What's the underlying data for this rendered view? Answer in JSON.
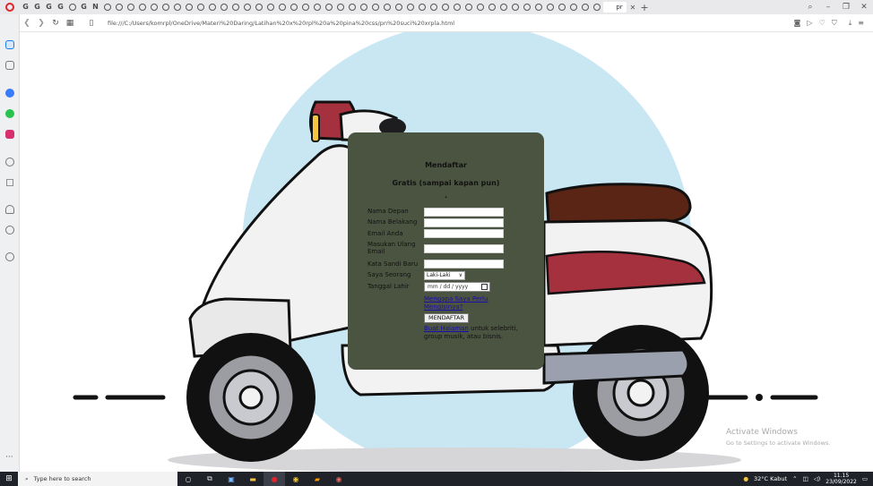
{
  "browser": {
    "tabs": [
      "G",
      "G",
      "G",
      "G",
      "",
      "G",
      "N",
      "",
      "",
      "",
      "",
      "",
      "",
      "",
      "",
      "",
      "",
      "",
      "",
      "",
      "",
      "",
      "",
      "",
      "",
      "",
      "",
      "",
      "",
      "",
      "",
      "",
      "",
      "",
      "",
      "",
      "",
      "",
      "",
      "",
      "",
      "",
      "",
      "",
      "",
      "",
      "",
      "",
      "",
      ""
    ],
    "active_tab_label": "pr",
    "url": "file:///C:/Users/komrpl/OneDrive/Materi%20Daring/Latihan%20x%20rpl%20a%20pina%20css/pn%20suci%20xrpla.html"
  },
  "form": {
    "title": "Mendaftar",
    "subtitle": "Gratis (sampai kapan pun)",
    "dot": ".",
    "labels": {
      "first_name": "Nama Depan",
      "last_name": "Nama Belakang",
      "email": "Email Anda",
      "email_repeat": "Masukan Ulang Email",
      "password": "Kata Sandi Baru",
      "gender": "Saya Seorang",
      "birthdate": "Tanggal Lahir"
    },
    "gender_selected": "Laki-Laki",
    "date_placeholder": "mm / dd / yyyy",
    "why_link": "Mengapa Saya Perlu Mengisinya?",
    "submit": "MENDAFTAR",
    "footer_link": "Buat Halaman",
    "footer_text": " untuk selebriti, group musik, atau bisnis."
  },
  "watermark": {
    "line1": "Activate Windows",
    "line2": "Go to Settings to activate Windows."
  },
  "taskbar": {
    "search_placeholder": "Type here to search",
    "weather": "32°C  Kabut",
    "time": "11.15",
    "date": "23/09/2022"
  },
  "colors": {
    "form_bg": "#4b5440",
    "circle_bg": "#c9e6f3",
    "accent_red": "#e0242c"
  }
}
